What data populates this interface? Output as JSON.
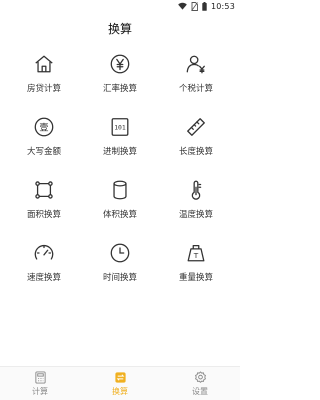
{
  "status_bar": {
    "time": "10:53"
  },
  "page": {
    "title": "换算"
  },
  "tools": [
    {
      "label": "房贷计算",
      "icon": "house-icon"
    },
    {
      "label": "汇率换算",
      "icon": "yen-icon"
    },
    {
      "label": "个税计算",
      "icon": "person-yen-icon"
    },
    {
      "label": "大写金额",
      "icon": "chinese-numeral-icon"
    },
    {
      "label": "进制换算",
      "icon": "binary-icon"
    },
    {
      "label": "长度换算",
      "icon": "ruler-icon"
    },
    {
      "label": "面积换算",
      "icon": "area-icon"
    },
    {
      "label": "体积换算",
      "icon": "cylinder-icon"
    },
    {
      "label": "温度换算",
      "icon": "thermometer-icon"
    },
    {
      "label": "速度换算",
      "icon": "speedometer-icon"
    },
    {
      "label": "时间换算",
      "icon": "clock-icon"
    },
    {
      "label": "重量换算",
      "icon": "weight-icon"
    }
  ],
  "icon_glyphs": {
    "chinese_numeral": "壹",
    "binary": "101",
    "weight": "T"
  },
  "bottom_nav": {
    "items": [
      {
        "label": "计算",
        "icon": "calculator-icon",
        "active": false
      },
      {
        "label": "换算",
        "icon": "convert-icon",
        "active": true
      },
      {
        "label": "设置",
        "icon": "gear-icon",
        "active": false
      }
    ]
  },
  "colors": {
    "accent": "#f0b020",
    "icon_stroke": "#333333",
    "inactive": "#888888"
  }
}
